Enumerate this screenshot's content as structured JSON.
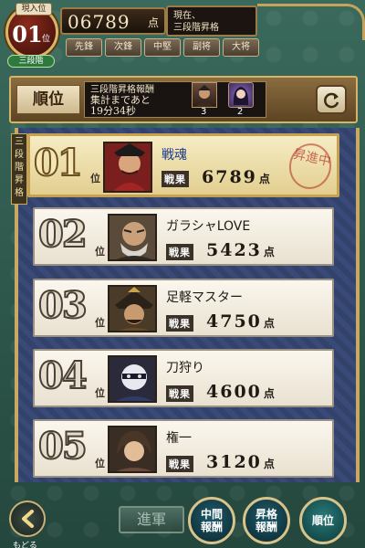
{
  "header": {
    "rank_caption": "現入位",
    "rank_number": "01",
    "rank_unit": "位",
    "tier": "三段階",
    "score": "06789",
    "score_unit": "点",
    "status_line1": "現在、",
    "status_line2": "三段階昇格",
    "position_tabs": [
      "先鋒",
      "次鋒",
      "中堅",
      "副将",
      "大将"
    ]
  },
  "title_bar": {
    "title": "順位",
    "reward_title": "三段階昇格報酬",
    "countdown_label": "集計まであと",
    "countdown_value": "19分34秒",
    "reward_items": [
      {
        "icon": "warrior-portrait-icon",
        "count": "3"
      },
      {
        "icon": "princess-portrait-icon",
        "count": "2"
      }
    ],
    "refresh_icon": "refresh-icon"
  },
  "side_banner": "三段階昇格",
  "rankings": [
    {
      "rank": "01",
      "unit": "位",
      "name": "戦魂",
      "score_label": "戦果",
      "score": "6789",
      "score_unit": "点",
      "stamp": "昇進中",
      "portrait": "warlord-red-armor"
    },
    {
      "rank": "02",
      "unit": "位",
      "name": "ガラシャLOVE",
      "score_label": "戦果",
      "score": "5423",
      "score_unit": "点",
      "portrait": "old-bald-general"
    },
    {
      "rank": "03",
      "unit": "位",
      "name": "足軽マスター",
      "score_label": "戦果",
      "score": "4750",
      "score_unit": "点",
      "portrait": "samurai-kabuto"
    },
    {
      "rank": "04",
      "unit": "位",
      "name": "刀狩り",
      "score_label": "戦果",
      "score": "4600",
      "score_unit": "点",
      "portrait": "masked-ninja"
    },
    {
      "rank": "05",
      "unit": "位",
      "name": "権一",
      "score_label": "戦果",
      "score": "3120",
      "score_unit": "点",
      "portrait": "young-samurai"
    }
  ],
  "footer": {
    "back_label": "もどる",
    "advance_label": "進軍",
    "btn_mid_reward": [
      "中間",
      "報酬"
    ],
    "btn_promo_reward": [
      "昇格",
      "報酬"
    ],
    "btn_ranking": "順位"
  }
}
